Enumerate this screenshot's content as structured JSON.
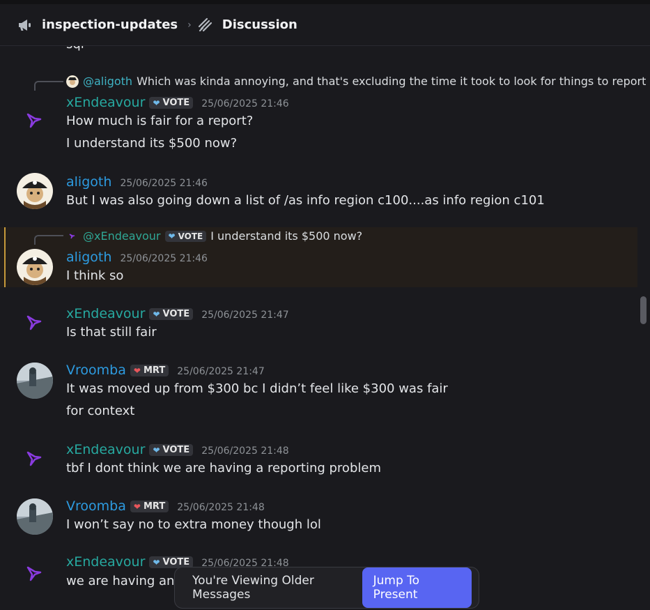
{
  "header": {
    "channel": "inspection-updates",
    "separator": "›",
    "thread": "Discussion"
  },
  "colors": {
    "xendeavour": "#27a9a0",
    "aligoth": "#2d9be0",
    "vroomba": "#2d9be0",
    "accent": "#5865f2",
    "highlight_bar": "#c79a3a"
  },
  "messages": {
    "m0": {
      "text": "sql"
    },
    "m1": {
      "reply_mention": "@aligoth",
      "reply_text": "Which was kinda annoying, and that's excluding the time it took to look for things to report",
      "user": "xEndeavour",
      "badge": "VOTE",
      "badge_icon": "blue-heart",
      "time": "25/06/2025 21:46",
      "lines": [
        "How much is fair for a report?",
        "I understand its $500 now?"
      ]
    },
    "m2": {
      "user": "aligoth",
      "time": "25/06/2025 21:46",
      "lines": [
        "But I was also going down a list of /as info region c100....as info region c101"
      ]
    },
    "m3": {
      "reply_mention": "@xEndeavour",
      "reply_badge": "VOTE",
      "reply_text": "I understand its $500 now?",
      "user": "aligoth",
      "time": "25/06/2025 21:46",
      "lines": [
        "I think so"
      ]
    },
    "m4": {
      "user": "xEndeavour",
      "badge": "VOTE",
      "time": "25/06/2025 21:47",
      "lines": [
        "Is that still fair"
      ]
    },
    "m5": {
      "user": "Vroomba",
      "badge": "MRT",
      "badge_icon": "red-heart",
      "time": "25/06/2025 21:47",
      "lines": [
        "It was moved up from $300 bc I didn’t feel like $300 was fair",
        "for context"
      ]
    },
    "m6": {
      "user": "xEndeavour",
      "badge": "VOTE",
      "time": "25/06/2025 21:48",
      "lines": [
        "tbf I dont think we are having a reporting problem"
      ]
    },
    "m7": {
      "user": "Vroomba",
      "badge": "MRT",
      "time": "25/06/2025 21:48",
      "lines": [
        "I won’t say no to extra money though lol"
      ]
    },
    "m8": {
      "user": "xEndeavour",
      "badge": "VOTE",
      "time": "25/06/2025 21:48",
      "lines": [
        "we are having an a"
      ]
    }
  },
  "older_bar": {
    "label": "You're Viewing Older Messages",
    "button": "Jump To Present"
  }
}
